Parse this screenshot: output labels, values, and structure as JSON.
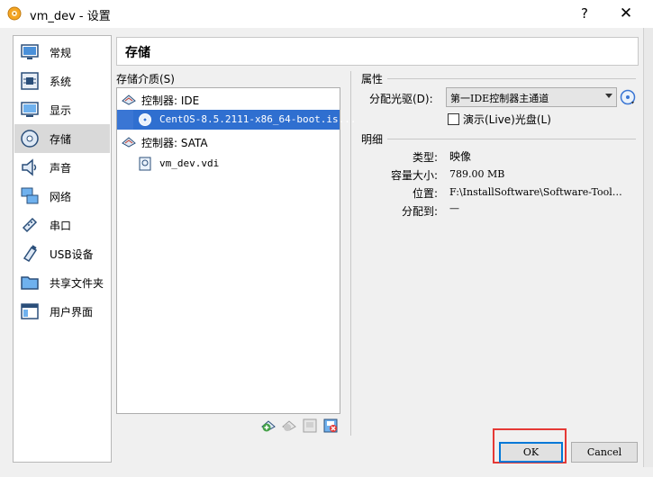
{
  "window": {
    "title": "vm_dev - 设置",
    "help_label": "?",
    "close_label": "✕"
  },
  "sidebar": {
    "items": [
      {
        "label": "常规",
        "icon": "general-icon"
      },
      {
        "label": "系统",
        "icon": "system-icon"
      },
      {
        "label": "显示",
        "icon": "display-icon"
      },
      {
        "label": "存储",
        "icon": "storage-icon",
        "selected": true
      },
      {
        "label": "声音",
        "icon": "audio-icon"
      },
      {
        "label": "网络",
        "icon": "network-icon"
      },
      {
        "label": "串口",
        "icon": "serial-port-icon"
      },
      {
        "label": "USB设备",
        "icon": "usb-icon"
      },
      {
        "label": "共享文件夹",
        "icon": "shared-folder-icon"
      },
      {
        "label": "用户界面",
        "icon": "user-interface-icon"
      }
    ]
  },
  "page": {
    "title": "存储"
  },
  "storage": {
    "label": "存储介质(S)",
    "tree": [
      {
        "kind": "controller",
        "label": "控制器: IDE"
      },
      {
        "kind": "disk",
        "label": "CentOS-8.5.2111-x86_64-boot.is...",
        "selected": true,
        "icon": "optical-disc-icon"
      },
      {
        "kind": "controller",
        "label": "控制器: SATA"
      },
      {
        "kind": "disk",
        "label": "vm_dev.vdi",
        "icon": "hard-disk-icon"
      }
    ],
    "buttons": [
      "add-controller-icon",
      "add-attachment-icon",
      "remove-attachment-icon",
      "remove-controller-icon"
    ]
  },
  "attributes": {
    "header": "属性",
    "drive_label": "分配光驱(D):",
    "drive_value": "第一IDE控制器主通道",
    "live_cd_label": "演示(Live)光盘(L)",
    "live_cd_checked": false
  },
  "details": {
    "header": "明细",
    "rows": [
      {
        "label": "类型:",
        "value": "映像"
      },
      {
        "label": "容量大小:",
        "value": "789.00 MB"
      },
      {
        "label": "位置:",
        "value": "F:\\InstallSoftware\\Software-Tool…"
      },
      {
        "label": "分配到:",
        "value": "—"
      }
    ]
  },
  "footer": {
    "ok_label": "OK",
    "cancel_label": "Cancel"
  },
  "colors": {
    "selection": "#3a76d4",
    "highlight_box": "#e53935",
    "default_button_border": "#0078d7"
  }
}
